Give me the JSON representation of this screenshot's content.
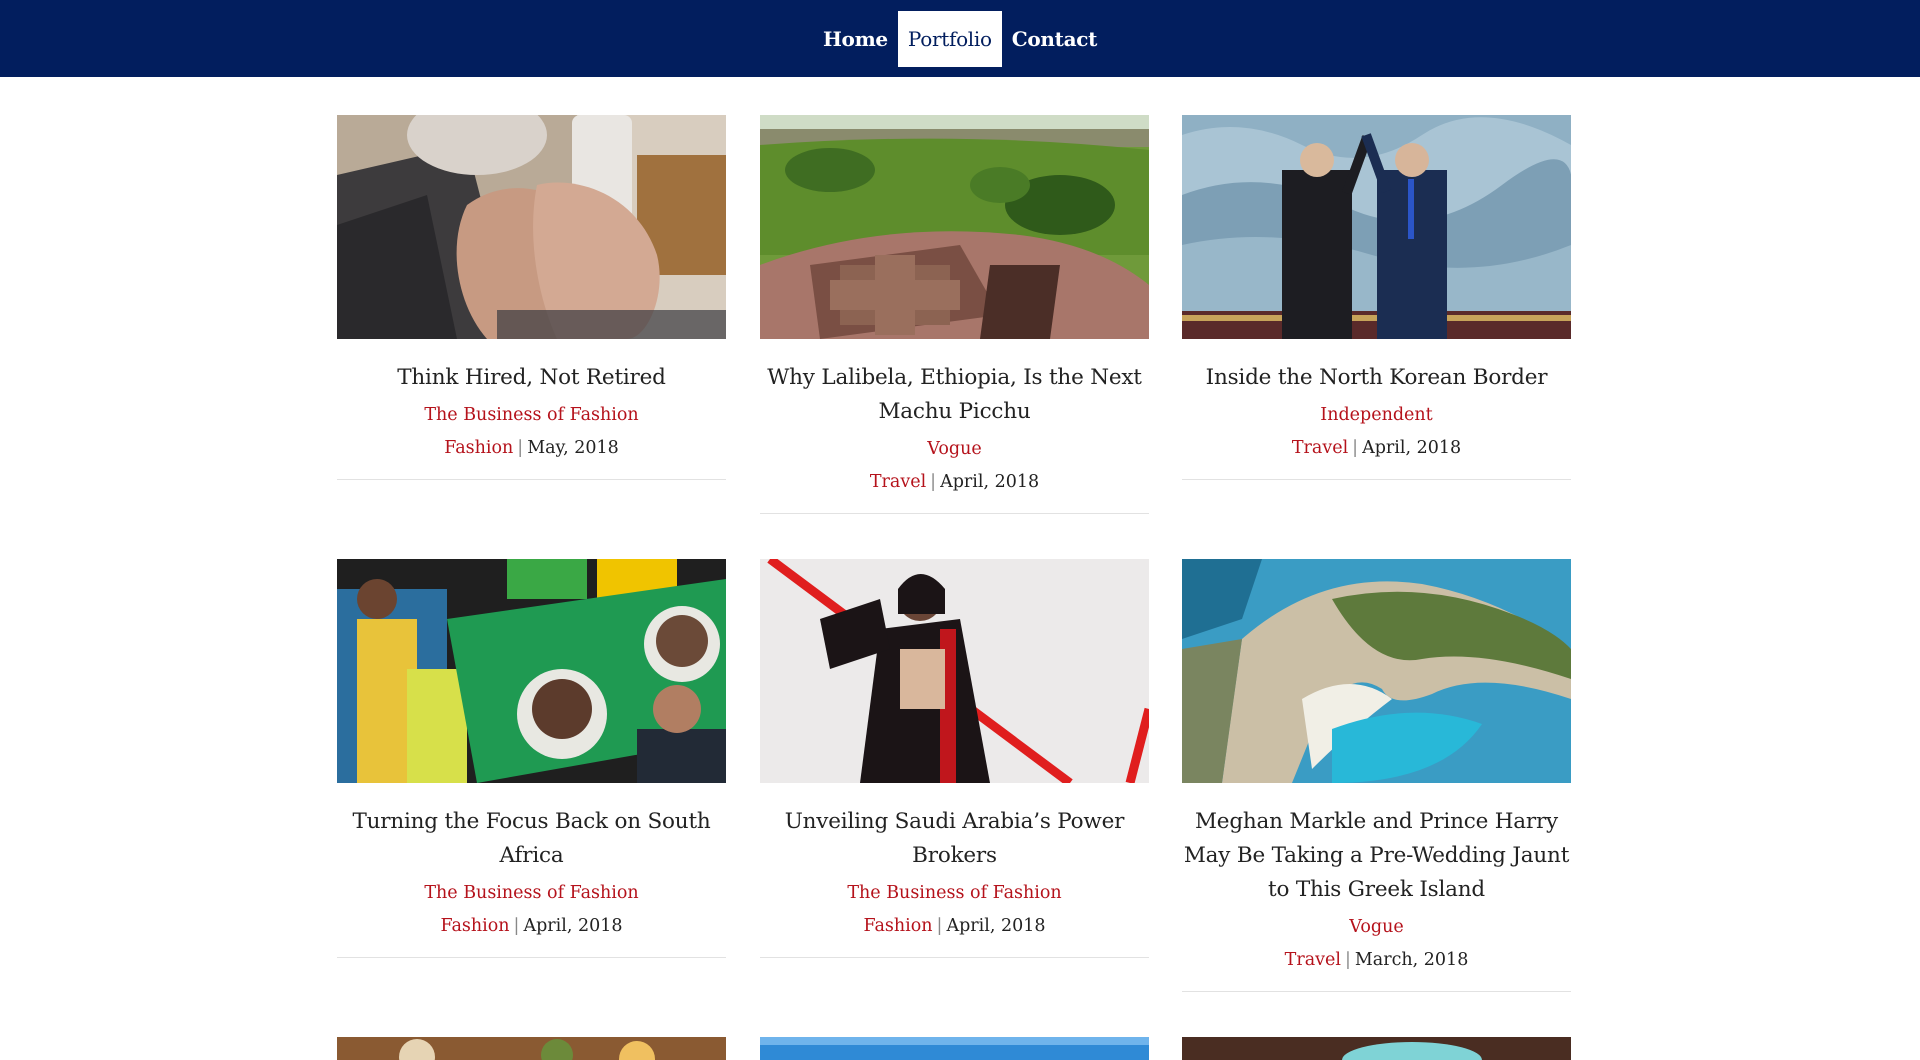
{
  "nav": {
    "items": [
      {
        "label": "Home",
        "active": false
      },
      {
        "label": "Portfolio",
        "active": true
      },
      {
        "label": "Contact",
        "active": false
      }
    ]
  },
  "articles": [
    {
      "title": "Think Hired, Not Retired",
      "publication": "The Business of Fashion",
      "category": "Fashion",
      "date": "May, 2018",
      "image": "hands-phone-photo"
    },
    {
      "title": "Why Lalibela, Ethiopia, Is the Next Machu Picchu",
      "publication": "Vogue",
      "category": "Travel",
      "date": "April, 2018",
      "image": "lalibela-church-photo"
    },
    {
      "title": "Inside the North Korean Border",
      "publication": "Independent",
      "category": "Travel",
      "date": "April, 2018",
      "image": "leaders-summit-photo"
    },
    {
      "title": "Turning the Focus Back on South Africa",
      "publication": "The Business of Fashion",
      "category": "Fashion",
      "date": "April, 2018",
      "image": "rally-flag-photo"
    },
    {
      "title": "Unveiling Saudi Arabia’s Power Brokers",
      "publication": "The Business of Fashion",
      "category": "Fashion",
      "date": "April, 2018",
      "image": "fashion-portrait-photo"
    },
    {
      "title": "Meghan Markle and Prince Harry May Be Taking a Pre-Wedding Jaunt to This Greek Island",
      "publication": "Vogue",
      "category": "Travel",
      "date": "March, 2018",
      "image": "greek-cove-photo"
    }
  ],
  "meta_separator": "|",
  "colors": {
    "navbar": "#021e5e",
    "accent": "#b5121b",
    "text": "#222222",
    "rule": "#e2e2e2"
  }
}
